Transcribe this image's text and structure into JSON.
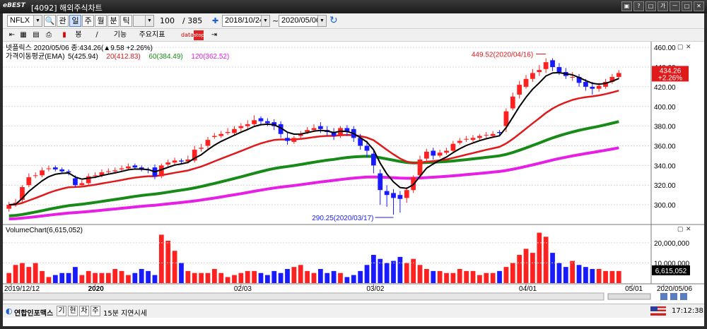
{
  "window": {
    "logo": "eBEST",
    "title": "[4092] 해외주식차트",
    "title_buttons": [
      "▣",
      "?",
      "□",
      "가",
      "ㅡ",
      "□",
      "✕"
    ]
  },
  "toolbar": {
    "symbol": "NFLX",
    "period_buttons": [
      "관",
      "일",
      "주",
      "월",
      "분",
      "틱"
    ],
    "count_value": "100",
    "count_total": "/ 385",
    "start_date": "2018/10/24",
    "end_date": "2020/05/06",
    "tools_label": "기능",
    "indicators_label": "주요지표",
    "chart_type_label": "봉"
  },
  "legend": {
    "price_line": "넷플릭스 2020/05/06 종:434.26(▲9.58 +2.26%)",
    "ema_label": "가격이동평균(EMA)",
    "ema_items": [
      {
        "text": "5(425.94)",
        "color": "#000000"
      },
      {
        "text": "20(412.83)",
        "color": "#e0191b"
      },
      {
        "text": "60(384.49)",
        "color": "#178a17"
      },
      {
        "text": "120(362.52)",
        "color": "#e61ee6"
      }
    ],
    "volume_label": "VolumeChart(6,615,052)"
  },
  "price_axis": {
    "ticks": [
      "460.00",
      "440.00",
      "420.00",
      "400.00",
      "380.00",
      "360.00",
      "340.00",
      "320.00",
      "300.00"
    ],
    "current_price": "434.26",
    "current_change": "+2.26%"
  },
  "volume_axis": {
    "ticks": [
      "20,000,000",
      "10,000,000"
    ],
    "current_volume": "6,615,052"
  },
  "annotations": {
    "high": "449.52(2020/04/16)",
    "low": "290.25(2020/03/17)"
  },
  "x_axis_labels": [
    "2019/12/12",
    "2020",
    "02/03",
    "03/02",
    "04/01",
    "05/01",
    "2020/05/06"
  ],
  "colors": {
    "up": "#ff2020",
    "down": "#1a1aff",
    "ema5": "#000000",
    "ema20": "#e0191b",
    "ema60": "#178a17",
    "ema120": "#e61ee6"
  },
  "statusbar": {
    "news_source": "연합인포맥스",
    "btns": [
      "기",
      "현",
      "차",
      "주"
    ],
    "delay_text": "15분 지연시세",
    "time": "17:12:38"
  },
  "chart_data": {
    "type": "candlestick",
    "x_start": "2019/12/12",
    "x_end": "2020/05/06",
    "ylim": [
      285,
      463
    ],
    "closes": [
      300,
      302,
      318,
      328,
      330,
      335,
      337,
      336,
      334,
      333,
      320,
      322,
      329,
      330,
      333,
      334,
      335,
      337,
      339,
      338,
      336,
      335,
      329,
      340,
      343,
      345,
      344,
      346,
      356,
      358,
      366,
      370,
      372,
      374,
      377,
      380,
      382,
      386,
      385,
      383,
      380,
      372,
      365,
      368,
      372,
      376,
      378,
      377,
      374,
      370,
      378,
      374,
      368,
      360,
      355,
      340,
      315,
      310,
      307,
      306,
      315,
      328,
      346,
      354,
      350,
      353,
      355,
      362,
      365,
      367,
      368,
      370,
      371,
      372,
      373,
      395,
      410,
      422,
      428,
      434,
      437,
      445,
      440,
      435,
      431,
      430,
      424,
      420,
      418,
      421,
      425,
      430,
      434
    ],
    "opens": [
      296,
      300,
      305,
      320,
      330,
      330,
      337,
      338,
      336,
      334,
      327,
      320,
      322,
      330,
      330,
      334,
      334,
      336,
      337,
      340,
      338,
      336,
      338,
      329,
      341,
      343,
      345,
      344,
      345,
      357,
      360,
      369,
      370,
      373,
      373,
      378,
      380,
      382,
      388,
      385,
      384,
      382,
      368,
      364,
      370,
      374,
      376,
      380,
      376,
      374,
      371,
      378,
      377,
      368,
      360,
      352,
      332,
      314,
      312,
      310,
      307,
      315,
      330,
      347,
      355,
      350,
      353,
      355,
      363,
      367,
      366,
      368,
      371,
      370,
      374,
      380,
      398,
      412,
      420,
      428,
      435,
      438,
      447,
      440,
      435,
      430,
      430,
      425,
      420,
      418,
      420,
      425,
      430
    ],
    "highs": [
      303,
      306,
      320,
      332,
      333,
      338,
      340,
      340,
      338,
      336,
      330,
      325,
      332,
      333,
      336,
      337,
      338,
      340,
      342,
      342,
      340,
      338,
      341,
      342,
      346,
      348,
      347,
      350,
      360,
      362,
      369,
      373,
      375,
      378,
      380,
      383,
      386,
      391,
      390,
      388,
      387,
      385,
      373,
      370,
      375,
      379,
      382,
      384,
      380,
      378,
      380,
      381,
      380,
      372,
      365,
      355,
      336,
      320,
      316,
      314,
      318,
      330,
      350,
      357,
      358,
      356,
      358,
      365,
      368,
      370,
      371,
      372,
      374,
      375,
      376,
      398,
      414,
      426,
      432,
      438,
      442,
      449,
      449,
      444,
      439,
      435,
      433,
      428,
      425,
      424,
      428,
      433,
      437
    ],
    "lows": [
      293,
      298,
      303,
      318,
      327,
      328,
      334,
      334,
      332,
      330,
      318,
      318,
      320,
      327,
      328,
      331,
      332,
      334,
      335,
      336,
      334,
      332,
      326,
      327,
      338,
      340,
      341,
      342,
      343,
      354,
      357,
      367,
      368,
      371,
      371,
      375,
      377,
      380,
      382,
      380,
      376,
      368,
      361,
      362,
      367,
      372,
      374,
      373,
      370,
      366,
      368,
      370,
      364,
      356,
      348,
      332,
      300,
      298,
      290,
      292,
      302,
      312,
      328,
      343,
      346,
      348,
      351,
      353,
      361,
      364,
      364,
      366,
      368,
      368,
      370,
      374,
      396,
      408,
      418,
      425,
      431,
      434,
      436,
      432,
      428,
      426,
      420,
      416,
      412,
      415,
      418,
      423,
      428
    ],
    "volumes": [
      5,
      9,
      10,
      8,
      10,
      6,
      3,
      4,
      5,
      5,
      8,
      4,
      6,
      5,
      5,
      5,
      7,
      6,
      4,
      5,
      7,
      6,
      4,
      24,
      21,
      16,
      10,
      6,
      5,
      5,
      5,
      7,
      5,
      3,
      4,
      5,
      6,
      6,
      5,
      4,
      6,
      5,
      7,
      8,
      9,
      6,
      5,
      7,
      5,
      6,
      5,
      3,
      4,
      6,
      9,
      14,
      12,
      10,
      11,
      13,
      10,
      12,
      9,
      7,
      6,
      6,
      5,
      5,
      7,
      6,
      6,
      4,
      5,
      5,
      6,
      8,
      10,
      14,
      17,
      15,
      25,
      23,
      15,
      10,
      8,
      11,
      9,
      8,
      7,
      7,
      6,
      6,
      6
    ],
    "volume_max": 28000000
  }
}
